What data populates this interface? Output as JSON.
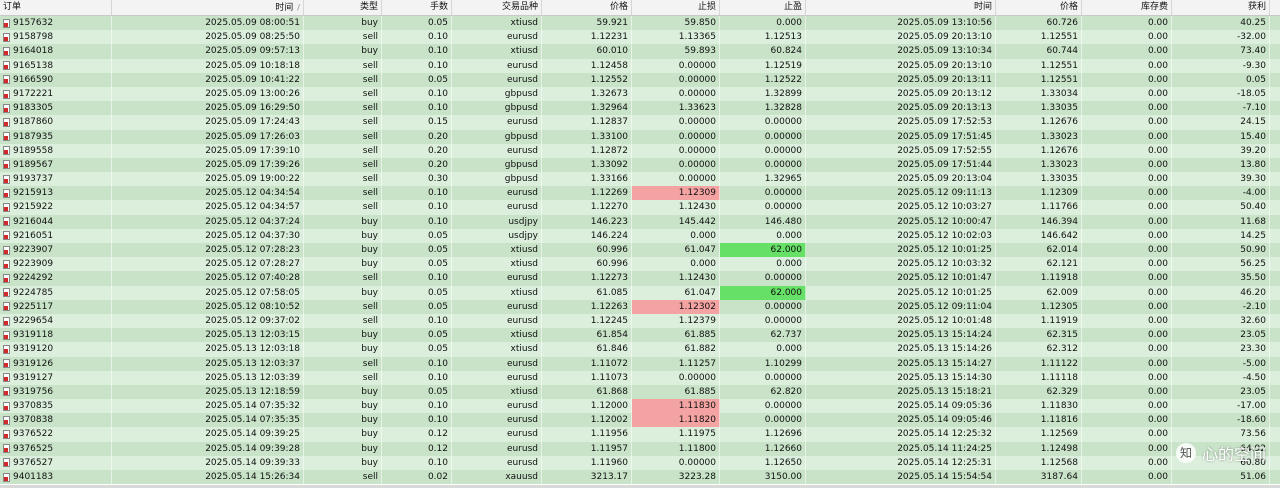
{
  "columns": [
    {
      "key": "ticket",
      "label": "订单",
      "sort": ""
    },
    {
      "key": "open_time",
      "label": "时间",
      "sort": "/"
    },
    {
      "key": "type",
      "label": "类型",
      "sort": ""
    },
    {
      "key": "lots",
      "label": "手数",
      "sort": ""
    },
    {
      "key": "symbol",
      "label": "交易品种",
      "sort": ""
    },
    {
      "key": "price",
      "label": "价格",
      "sort": ""
    },
    {
      "key": "sl",
      "label": "止损",
      "sort": ""
    },
    {
      "key": "tp",
      "label": "止盈",
      "sort": ""
    },
    {
      "key": "close_time",
      "label": "时间",
      "sort": ""
    },
    {
      "key": "close_price",
      "label": "价格",
      "sort": ""
    },
    {
      "key": "swap",
      "label": "库存费",
      "sort": ""
    },
    {
      "key": "profit",
      "label": "获利",
      "sort": ""
    }
  ],
  "colors": {
    "highlight_red": "#f4a3a3",
    "highlight_green": "#66e066",
    "row_odd": "#c8e3c8",
    "row_even": "#dcefdc"
  },
  "rows": [
    {
      "ticket": "9157632",
      "open_time": "2025.05.09 08:00:51",
      "type": "buy",
      "lots": "0.05",
      "symbol": "xtiusd",
      "price": "59.921",
      "sl": "59.850",
      "tp": "0.000",
      "close_time": "2025.05.09 13:10:56",
      "close_price": "60.726",
      "swap": "0.00",
      "profit": "40.25"
    },
    {
      "ticket": "9158798",
      "open_time": "2025.05.09 08:25:50",
      "type": "sell",
      "lots": "0.10",
      "symbol": "eurusd",
      "price": "1.12231",
      "sl": "1.13365",
      "tp": "1.12513",
      "close_time": "2025.05.09 20:13:10",
      "close_price": "1.12551",
      "swap": "0.00",
      "profit": "-32.00"
    },
    {
      "ticket": "9164018",
      "open_time": "2025.05.09 09:57:13",
      "type": "buy",
      "lots": "0.10",
      "symbol": "xtiusd",
      "price": "60.010",
      "sl": "59.893",
      "tp": "60.824",
      "close_time": "2025.05.09 13:10:34",
      "close_price": "60.744",
      "swap": "0.00",
      "profit": "73.40"
    },
    {
      "ticket": "9165138",
      "open_time": "2025.05.09 10:18:18",
      "type": "sell",
      "lots": "0.10",
      "symbol": "eurusd",
      "price": "1.12458",
      "sl": "0.00000",
      "tp": "1.12519",
      "close_time": "2025.05.09 20:13:10",
      "close_price": "1.12551",
      "swap": "0.00",
      "profit": "-9.30"
    },
    {
      "ticket": "9166590",
      "open_time": "2025.05.09 10:41:22",
      "type": "sell",
      "lots": "0.05",
      "symbol": "eurusd",
      "price": "1.12552",
      "sl": "0.00000",
      "tp": "1.12522",
      "close_time": "2025.05.09 20:13:11",
      "close_price": "1.12551",
      "swap": "0.00",
      "profit": "0.05"
    },
    {
      "ticket": "9172221",
      "open_time": "2025.05.09 13:00:26",
      "type": "sell",
      "lots": "0.10",
      "symbol": "gbpusd",
      "price": "1.32673",
      "sl": "0.00000",
      "tp": "1.32899",
      "close_time": "2025.05.09 20:13:12",
      "close_price": "1.33034",
      "swap": "0.00",
      "profit": "-18.05"
    },
    {
      "ticket": "9183305",
      "open_time": "2025.05.09 16:29:50",
      "type": "sell",
      "lots": "0.10",
      "symbol": "gbpusd",
      "price": "1.32964",
      "sl": "1.33623",
      "tp": "1.32828",
      "close_time": "2025.05.09 20:13:13",
      "close_price": "1.33035",
      "swap": "0.00",
      "profit": "-7.10"
    },
    {
      "ticket": "9187860",
      "open_time": "2025.05.09 17:24:43",
      "type": "sell",
      "lots": "0.15",
      "symbol": "eurusd",
      "price": "1.12837",
      "sl": "0.00000",
      "tp": "0.00000",
      "close_time": "2025.05.09 17:52:53",
      "close_price": "1.12676",
      "swap": "0.00",
      "profit": "24.15"
    },
    {
      "ticket": "9187935",
      "open_time": "2025.05.09 17:26:03",
      "type": "sell",
      "lots": "0.20",
      "symbol": "gbpusd",
      "price": "1.33100",
      "sl": "0.00000",
      "tp": "0.00000",
      "close_time": "2025.05.09 17:51:45",
      "close_price": "1.33023",
      "swap": "0.00",
      "profit": "15.40"
    },
    {
      "ticket": "9189558",
      "open_time": "2025.05.09 17:39:10",
      "type": "sell",
      "lots": "0.20",
      "symbol": "eurusd",
      "price": "1.12872",
      "sl": "0.00000",
      "tp": "0.00000",
      "close_time": "2025.05.09 17:52:55",
      "close_price": "1.12676",
      "swap": "0.00",
      "profit": "39.20"
    },
    {
      "ticket": "9189567",
      "open_time": "2025.05.09 17:39:26",
      "type": "sell",
      "lots": "0.20",
      "symbol": "gbpusd",
      "price": "1.33092",
      "sl": "0.00000",
      "tp": "0.00000",
      "close_time": "2025.05.09 17:51:44",
      "close_price": "1.33023",
      "swap": "0.00",
      "profit": "13.80"
    },
    {
      "ticket": "9193737",
      "open_time": "2025.05.09 19:00:22",
      "type": "sell",
      "lots": "0.30",
      "symbol": "gbpusd",
      "price": "1.33166",
      "sl": "0.00000",
      "tp": "1.32965",
      "close_time": "2025.05.09 20:13:04",
      "close_price": "1.33035",
      "swap": "0.00",
      "profit": "39.30"
    },
    {
      "ticket": "9215913",
      "open_time": "2025.05.12 04:34:54",
      "type": "sell",
      "lots": "0.10",
      "symbol": "eurusd",
      "price": "1.12269",
      "sl": "1.12309",
      "sl_hl": "red",
      "tp": "0.00000",
      "close_time": "2025.05.12 09:11:13",
      "close_price": "1.12309",
      "swap": "0.00",
      "profit": "-4.00"
    },
    {
      "ticket": "9215922",
      "open_time": "2025.05.12 04:34:57",
      "type": "sell",
      "lots": "0.10",
      "symbol": "eurusd",
      "price": "1.12270",
      "sl": "1.12430",
      "tp": "0.00000",
      "close_time": "2025.05.12 10:03:27",
      "close_price": "1.11766",
      "swap": "0.00",
      "profit": "50.40"
    },
    {
      "ticket": "9216044",
      "open_time": "2025.05.12 04:37:24",
      "type": "buy",
      "lots": "0.10",
      "symbol": "usdjpy",
      "price": "146.223",
      "sl": "145.442",
      "tp": "146.480",
      "close_time": "2025.05.12 10:00:47",
      "close_price": "146.394",
      "swap": "0.00",
      "profit": "11.68"
    },
    {
      "ticket": "9216051",
      "open_time": "2025.05.12 04:37:30",
      "type": "buy",
      "lots": "0.05",
      "symbol": "usdjpy",
      "price": "146.224",
      "sl": "0.000",
      "tp": "0.000",
      "close_time": "2025.05.12 10:02:03",
      "close_price": "146.642",
      "swap": "0.00",
      "profit": "14.25"
    },
    {
      "ticket": "9223907",
      "open_time": "2025.05.12 07:28:23",
      "type": "buy",
      "lots": "0.05",
      "symbol": "xtiusd",
      "price": "60.996",
      "sl": "61.047",
      "tp": "62.000",
      "tp_hl": "green",
      "close_time": "2025.05.12 10:01:25",
      "close_price": "62.014",
      "swap": "0.00",
      "profit": "50.90"
    },
    {
      "ticket": "9223909",
      "open_time": "2025.05.12 07:28:27",
      "type": "buy",
      "lots": "0.05",
      "symbol": "xtiusd",
      "price": "60.996",
      "sl": "0.000",
      "tp": "0.000",
      "close_time": "2025.05.12 10:03:32",
      "close_price": "62.121",
      "swap": "0.00",
      "profit": "56.25"
    },
    {
      "ticket": "9224292",
      "open_time": "2025.05.12 07:40:28",
      "type": "sell",
      "lots": "0.10",
      "symbol": "eurusd",
      "price": "1.12273",
      "sl": "1.12430",
      "tp": "0.00000",
      "close_time": "2025.05.12 10:01:47",
      "close_price": "1.11918",
      "swap": "0.00",
      "profit": "35.50"
    },
    {
      "ticket": "9224785",
      "open_time": "2025.05.12 07:58:05",
      "type": "buy",
      "lots": "0.05",
      "symbol": "xtiusd",
      "price": "61.085",
      "sl": "61.047",
      "tp": "62.000",
      "tp_hl": "green",
      "close_time": "2025.05.12 10:01:25",
      "close_price": "62.009",
      "swap": "0.00",
      "profit": "46.20"
    },
    {
      "ticket": "9225117",
      "open_time": "2025.05.12 08:10:52",
      "type": "sell",
      "lots": "0.05",
      "symbol": "eurusd",
      "price": "1.12263",
      "sl": "1.12302",
      "sl_hl": "red",
      "tp": "0.00000",
      "close_time": "2025.05.12 09:11:04",
      "close_price": "1.12305",
      "swap": "0.00",
      "profit": "-2.10"
    },
    {
      "ticket": "9229654",
      "open_time": "2025.05.12 09:37:02",
      "type": "sell",
      "lots": "0.10",
      "symbol": "eurusd",
      "price": "1.12245",
      "sl": "1.12379",
      "tp": "0.00000",
      "close_time": "2025.05.12 10:01:48",
      "close_price": "1.11919",
      "swap": "0.00",
      "profit": "32.60"
    },
    {
      "ticket": "9319118",
      "open_time": "2025.05.13 12:03:15",
      "type": "buy",
      "lots": "0.05",
      "symbol": "xtiusd",
      "price": "61.854",
      "sl": "61.885",
      "tp": "62.737",
      "close_time": "2025.05.13 15:14:24",
      "close_price": "62.315",
      "swap": "0.00",
      "profit": "23.05"
    },
    {
      "ticket": "9319120",
      "open_time": "2025.05.13 12:03:18",
      "type": "buy",
      "lots": "0.05",
      "symbol": "xtiusd",
      "price": "61.846",
      "sl": "61.882",
      "tp": "0.000",
      "close_time": "2025.05.13 15:14:26",
      "close_price": "62.312",
      "swap": "0.00",
      "profit": "23.30"
    },
    {
      "ticket": "9319126",
      "open_time": "2025.05.13 12:03:37",
      "type": "sell",
      "lots": "0.10",
      "symbol": "eurusd",
      "price": "1.11072",
      "sl": "1.11257",
      "tp": "1.10299",
      "close_time": "2025.05.13 15:14:27",
      "close_price": "1.11122",
      "swap": "0.00",
      "profit": "-5.00"
    },
    {
      "ticket": "9319127",
      "open_time": "2025.05.13 12:03:39",
      "type": "sell",
      "lots": "0.10",
      "symbol": "eurusd",
      "price": "1.11073",
      "sl": "0.00000",
      "tp": "0.00000",
      "close_time": "2025.05.13 15:14:30",
      "close_price": "1.11118",
      "swap": "0.00",
      "profit": "-4.50"
    },
    {
      "ticket": "9319756",
      "open_time": "2025.05.13 12:18:59",
      "type": "buy",
      "lots": "0.05",
      "symbol": "xtiusd",
      "price": "61.868",
      "sl": "61.885",
      "tp": "62.820",
      "close_time": "2025.05.13 15:18:21",
      "close_price": "62.329",
      "swap": "0.00",
      "profit": "23.05"
    },
    {
      "ticket": "9370835",
      "open_time": "2025.05.14 07:35:32",
      "type": "buy",
      "lots": "0.10",
      "symbol": "eurusd",
      "price": "1.12000",
      "sl": "1.11830",
      "sl_hl": "red",
      "tp": "0.00000",
      "close_time": "2025.05.14 09:05:36",
      "close_price": "1.11830",
      "swap": "0.00",
      "profit": "-17.00"
    },
    {
      "ticket": "9370838",
      "open_time": "2025.05.14 07:35:35",
      "type": "buy",
      "lots": "0.10",
      "symbol": "eurusd",
      "price": "1.12002",
      "sl": "1.11820",
      "sl_hl": "red",
      "tp": "0.00000",
      "close_time": "2025.05.14 09:05:46",
      "close_price": "1.11816",
      "swap": "0.00",
      "profit": "-18.60"
    },
    {
      "ticket": "9376522",
      "open_time": "2025.05.14 09:39:25",
      "type": "buy",
      "lots": "0.12",
      "symbol": "eurusd",
      "price": "1.11956",
      "sl": "1.11975",
      "tp": "1.12696",
      "close_time": "2025.05.14 12:25:32",
      "close_price": "1.12569",
      "swap": "0.00",
      "profit": "73.56"
    },
    {
      "ticket": "9376525",
      "open_time": "2025.05.14 09:39:28",
      "type": "buy",
      "lots": "0.12",
      "symbol": "eurusd",
      "price": "1.11957",
      "sl": "1.11800",
      "tp": "1.12660",
      "close_time": "2025.05.14 11:24:25",
      "close_price": "1.12498",
      "swap": "0.00",
      "profit": "64.92"
    },
    {
      "ticket": "9376527",
      "open_time": "2025.05.14 09:39:33",
      "type": "buy",
      "lots": "0.10",
      "symbol": "eurusd",
      "price": "1.11960",
      "sl": "0.00000",
      "tp": "1.12650",
      "close_time": "2025.05.14 12:25:31",
      "close_price": "1.12568",
      "swap": "0.00",
      "profit": "60.80"
    },
    {
      "ticket": "9401183",
      "open_time": "2025.05.14 15:26:34",
      "type": "sell",
      "lots": "0.02",
      "symbol": "xauusd",
      "price": "3213.17",
      "sl": "3223.28",
      "tp": "3150.00",
      "close_time": "2025.05.14 15:54:54",
      "close_price": "3187.64",
      "swap": "0.00",
      "profit": "51.06"
    }
  ],
  "watermark": {
    "text": "心的空间"
  }
}
